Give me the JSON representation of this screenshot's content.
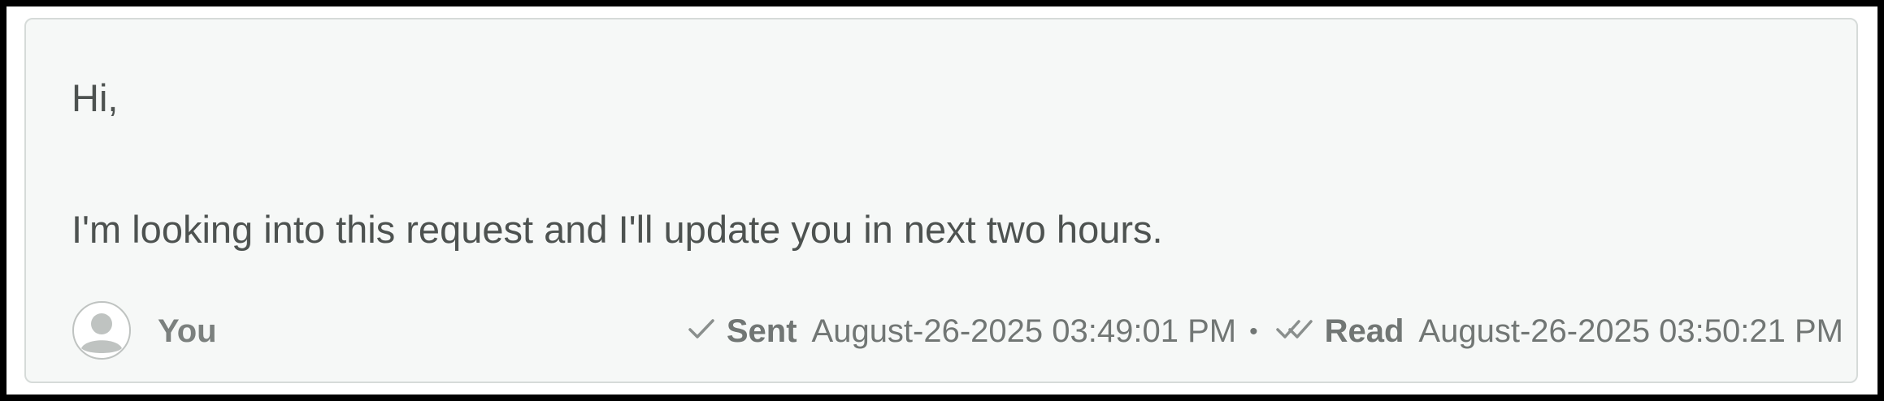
{
  "message": {
    "greeting": "Hi,",
    "body": "I'm looking into this request and I'll update you in next two hours."
  },
  "footer": {
    "author": "You",
    "avatar_icon": "user-avatar-icon",
    "sent": {
      "icon": "check-icon",
      "label": "Sent",
      "timestamp": "August-26-2025 03:49:01 PM"
    },
    "separator": "•",
    "read": {
      "icon": "double-check-icon",
      "label": "Read",
      "timestamp": "August-26-2025 03:50:21 PM"
    }
  },
  "colors": {
    "card_background": "#f6f8f7",
    "card_border": "#d6dbd9",
    "text": "#4d5250",
    "meta_text": "#717674"
  }
}
